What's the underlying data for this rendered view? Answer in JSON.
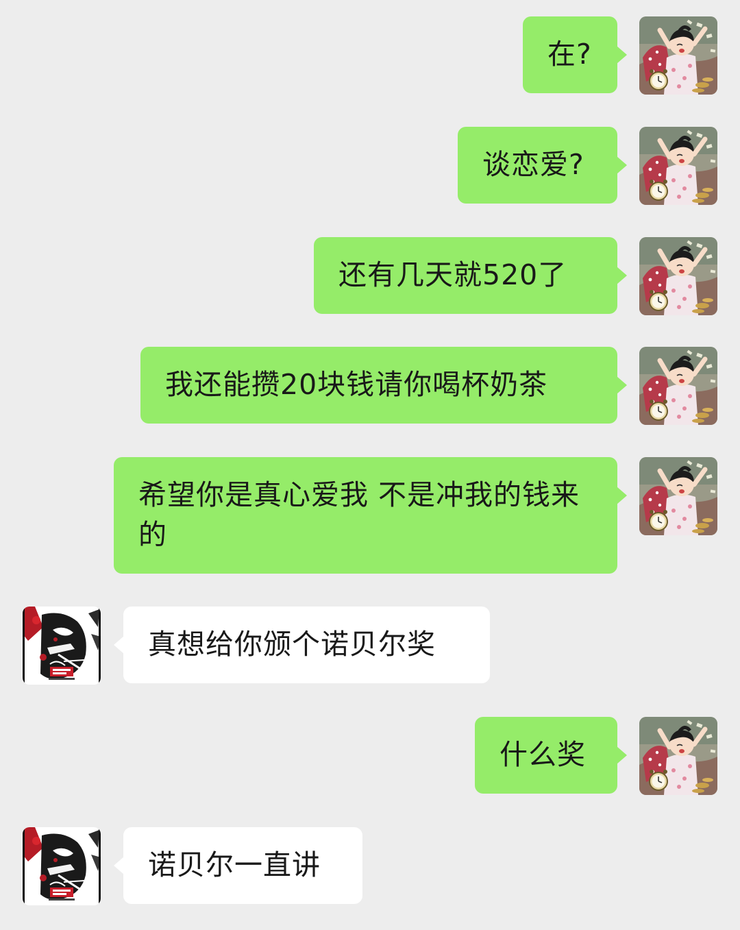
{
  "conversation": {
    "self_avatar_icon": "cartoon-girl-avatar-icon",
    "contact_avatar_icon": "manga-character-avatar-icon",
    "colors": {
      "background": "#ededed",
      "sent_bubble": "#95ec69",
      "received_bubble": "#ffffff",
      "text": "#191919"
    },
    "messages": [
      {
        "sender": "me",
        "text": "在?"
      },
      {
        "sender": "me",
        "text": "谈恋爱?"
      },
      {
        "sender": "me",
        "text": "还有几天就520了"
      },
      {
        "sender": "me",
        "text": "我还能攒20块钱请你喝杯奶茶"
      },
      {
        "sender": "me",
        "text": "希望你是真心爱我 不是冲我的钱来的"
      },
      {
        "sender": "them",
        "text": "真想给你颁个诺贝尔奖"
      },
      {
        "sender": "me",
        "text": "什么奖"
      },
      {
        "sender": "them",
        "text": "诺贝尔一直讲"
      }
    ]
  }
}
